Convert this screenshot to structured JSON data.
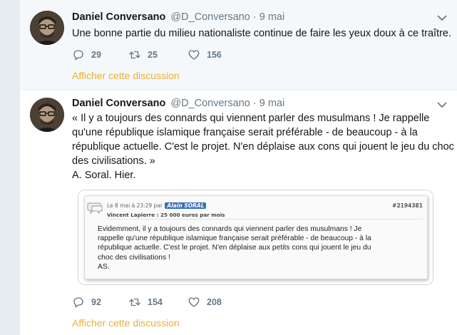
{
  "tweets": [
    {
      "name": "Daniel Conversano",
      "handle": "@D_Conversano",
      "dot": "·",
      "date": "9 mai",
      "text_lines": [
        "Une bonne partie du milieu nationaliste continue de faire les yeux doux à ce traître."
      ],
      "replies": "29",
      "retweets": "25",
      "likes": "156",
      "show_thread": "Afficher cette discussion"
    },
    {
      "name": "Daniel Conversano",
      "handle": "@D_Conversano",
      "dot": "·",
      "date": "9 mai",
      "text_lines": [
        "« Il y a toujours des connards qui viennent parler des musulmans ! Je rappelle",
        "qu'une république islamique française serait préférable - de beaucoup - à la",
        "république actuelle. C'est le projet. N'en déplaise aux cons qui jouent le jeu du choc",
        "des civilisations. »",
        "A. Soral. Hier."
      ],
      "replies": "92",
      "retweets": "154",
      "likes": "208",
      "show_thread": "Afficher cette discussion",
      "media": {
        "meta_prefix": "Le 8 mai à 23:29 par",
        "author": "Alain SORAL",
        "sub": "Vincent Lapierre : 25 000 euros par mois",
        "post_id": "#2194381",
        "lines": [
          "Evidemment, il y a toujours des connards qui viennent parler des musulmans ! Je",
          "rappelle qu'une république islamique française serait préférable - de beaucoup - à la",
          "république actuelle. C'est le projet. N'en déplaise aux petits cons qui jouent le jeu du",
          "choc des civilisations !",
          "AS."
        ]
      }
    }
  ],
  "colors": {
    "accent": "#e8b033",
    "muted": "#657786",
    "background": "#e6ecf0"
  },
  "icons": [
    "reply-icon",
    "retweet-icon",
    "like-icon",
    "caret-down-icon",
    "speech-bubble-icon"
  ]
}
